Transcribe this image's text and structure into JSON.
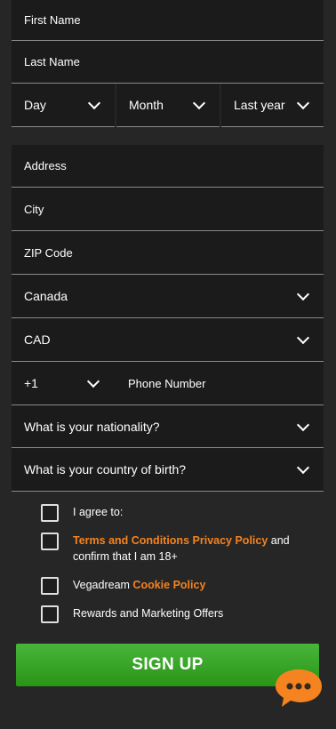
{
  "personal": {
    "first_name": "First Name",
    "last_name": "Last Name",
    "dob_day": "Day",
    "dob_month": "Month",
    "dob_year": "Last year"
  },
  "address": {
    "address": "Address",
    "city": "City",
    "zip": "ZIP Code",
    "country": "Canada",
    "currency": "CAD",
    "phone_code": "+1",
    "phone_number": "Phone Number",
    "nationality": "What is your nationality?",
    "country_of_birth": "What is your country of birth?"
  },
  "agreements": {
    "agree_to": "I agree to:",
    "terms_link": "Terms and Conditions",
    "privacy_link": "Privacy Policy",
    "age_text_1": " and",
    "age_text_2": "confirm that I am 18+",
    "cookie_prefix": "Vegadream ",
    "cookie_link": "Cookie Policy",
    "marketing": "Rewards and Marketing Offers"
  },
  "actions": {
    "signup_label": "SIGN UP"
  },
  "colors": {
    "accent_orange": "#f5831f",
    "signup_green": "#3aa52a",
    "field_bg": "#1b1b1b",
    "page_bg": "#262626"
  },
  "icons": {
    "dropdown": "chevron-down-icon",
    "chat": "chat-bubble-icon"
  }
}
